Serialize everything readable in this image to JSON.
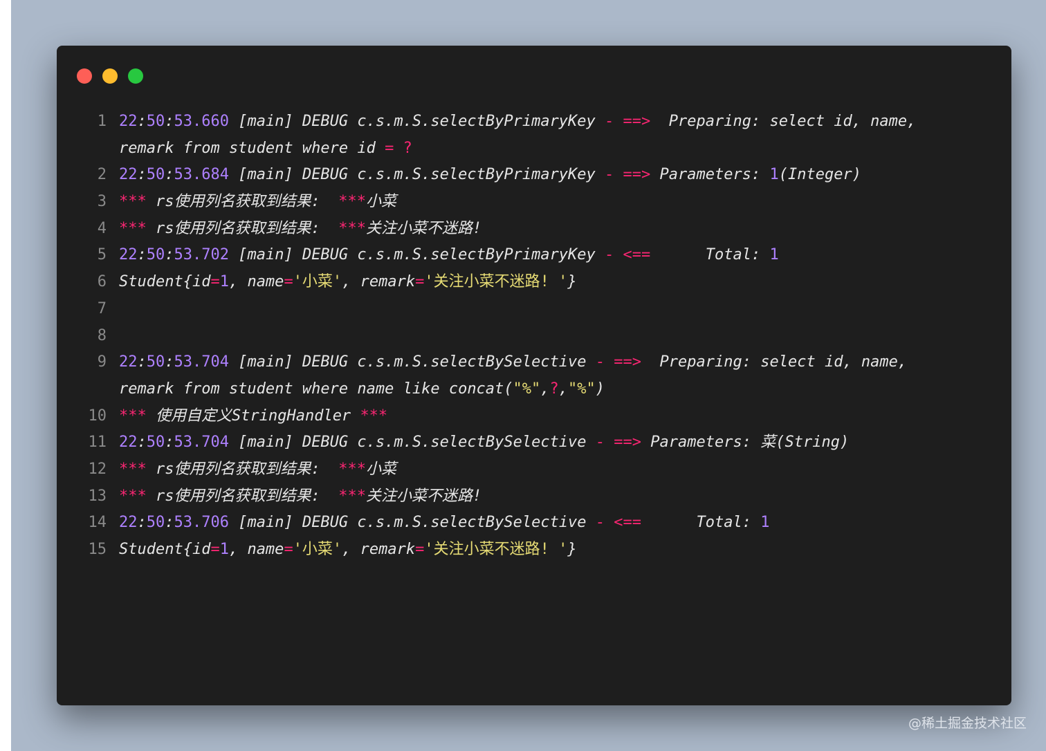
{
  "window": {
    "controls": [
      "close",
      "minimize",
      "maximize"
    ]
  },
  "lines": [
    {
      "num": "1",
      "rows": [
        [
          [
            "n",
            "22"
          ],
          [
            "p",
            ":"
          ],
          [
            "n",
            "50"
          ],
          [
            "p",
            ":"
          ],
          [
            "n",
            "53.660"
          ],
          [
            "p",
            " [main] DEBUG c.s.m.S.selectByPrimaryKey "
          ],
          [
            "op",
            "-"
          ],
          [
            "p",
            " "
          ],
          [
            "op",
            "==>"
          ],
          [
            "p",
            "  Preparing: select id, name,"
          ]
        ],
        [
          [
            "p",
            "remark from student where id "
          ],
          [
            "op",
            "="
          ],
          [
            "p",
            " "
          ],
          [
            "op",
            "?"
          ]
        ]
      ]
    },
    {
      "num": "2",
      "rows": [
        [
          [
            "n",
            "22"
          ],
          [
            "p",
            ":"
          ],
          [
            "n",
            "50"
          ],
          [
            "p",
            ":"
          ],
          [
            "n",
            "53.684"
          ],
          [
            "p",
            " [main] DEBUG c.s.m.S.selectByPrimaryKey "
          ],
          [
            "op",
            "-"
          ],
          [
            "p",
            " "
          ],
          [
            "op",
            "==>"
          ],
          [
            "p",
            " Parameters: "
          ],
          [
            "n",
            "1"
          ],
          [
            "p",
            "(Integer)"
          ]
        ]
      ]
    },
    {
      "num": "3",
      "rows": [
        [
          [
            "op",
            "***"
          ],
          [
            "p",
            " rs使用列名获取到结果:  "
          ],
          [
            "op",
            "***"
          ],
          [
            "p",
            "小菜"
          ]
        ]
      ]
    },
    {
      "num": "4",
      "rows": [
        [
          [
            "op",
            "***"
          ],
          [
            "p",
            " rs使用列名获取到结果:  "
          ],
          [
            "op",
            "***"
          ],
          [
            "p",
            "关注小菜不迷路!"
          ]
        ]
      ]
    },
    {
      "num": "5",
      "rows": [
        [
          [
            "n",
            "22"
          ],
          [
            "p",
            ":"
          ],
          [
            "n",
            "50"
          ],
          [
            "p",
            ":"
          ],
          [
            "n",
            "53.702"
          ],
          [
            "p",
            " [main] DEBUG c.s.m.S.selectByPrimaryKey "
          ],
          [
            "op",
            "-"
          ],
          [
            "p",
            " "
          ],
          [
            "op",
            "<=="
          ],
          [
            "p",
            "      Total: "
          ],
          [
            "n",
            "1"
          ]
        ]
      ]
    },
    {
      "num": "6",
      "rows": [
        [
          [
            "p",
            "Student{id"
          ],
          [
            "op",
            "="
          ],
          [
            "n",
            "1"
          ],
          [
            "p",
            ", name"
          ],
          [
            "op",
            "="
          ],
          [
            "s",
            "'小菜'"
          ],
          [
            "p",
            ", remark"
          ],
          [
            "op",
            "="
          ],
          [
            "s",
            "'关注小菜不迷路! '"
          ],
          [
            "p",
            "}"
          ]
        ]
      ]
    },
    {
      "num": "7",
      "rows": [
        [
          [
            "p",
            ""
          ]
        ]
      ]
    },
    {
      "num": "8",
      "rows": [
        [
          [
            "p",
            ""
          ]
        ]
      ]
    },
    {
      "num": "9",
      "rows": [
        [
          [
            "n",
            "22"
          ],
          [
            "p",
            ":"
          ],
          [
            "n",
            "50"
          ],
          [
            "p",
            ":"
          ],
          [
            "n",
            "53.704"
          ],
          [
            "p",
            " [main] DEBUG c.s.m.S.selectBySelective "
          ],
          [
            "op",
            "-"
          ],
          [
            "p",
            " "
          ],
          [
            "op",
            "==>"
          ],
          [
            "p",
            "  Preparing: select id, name,"
          ]
        ],
        [
          [
            "p",
            "remark from student where name like concat("
          ],
          [
            "s",
            "\"%\""
          ],
          [
            "p",
            ","
          ],
          [
            "op",
            "?"
          ],
          [
            "p",
            ","
          ],
          [
            "s",
            "\"%\""
          ],
          [
            "p",
            ")"
          ]
        ]
      ]
    },
    {
      "num": "10",
      "rows": [
        [
          [
            "op",
            "***"
          ],
          [
            "p",
            " 使用自定义StringHandler "
          ],
          [
            "op",
            "***"
          ]
        ]
      ]
    },
    {
      "num": "11",
      "rows": [
        [
          [
            "n",
            "22"
          ],
          [
            "p",
            ":"
          ],
          [
            "n",
            "50"
          ],
          [
            "p",
            ":"
          ],
          [
            "n",
            "53.704"
          ],
          [
            "p",
            " [main] DEBUG c.s.m.S.selectBySelective "
          ],
          [
            "op",
            "-"
          ],
          [
            "p",
            " "
          ],
          [
            "op",
            "==>"
          ],
          [
            "p",
            " Parameters: 菜(String)"
          ]
        ]
      ]
    },
    {
      "num": "12",
      "rows": [
        [
          [
            "op",
            "***"
          ],
          [
            "p",
            " rs使用列名获取到结果:  "
          ],
          [
            "op",
            "***"
          ],
          [
            "p",
            "小菜"
          ]
        ]
      ]
    },
    {
      "num": "13",
      "rows": [
        [
          [
            "op",
            "***"
          ],
          [
            "p",
            " rs使用列名获取到结果:  "
          ],
          [
            "op",
            "***"
          ],
          [
            "p",
            "关注小菜不迷路!"
          ]
        ]
      ]
    },
    {
      "num": "14",
      "rows": [
        [
          [
            "n",
            "22"
          ],
          [
            "p",
            ":"
          ],
          [
            "n",
            "50"
          ],
          [
            "p",
            ":"
          ],
          [
            "n",
            "53.706"
          ],
          [
            "p",
            " [main] DEBUG c.s.m.S.selectBySelective "
          ],
          [
            "op",
            "-"
          ],
          [
            "p",
            " "
          ],
          [
            "op",
            "<=="
          ],
          [
            "p",
            "      Total: "
          ],
          [
            "n",
            "1"
          ]
        ]
      ]
    },
    {
      "num": "15",
      "rows": [
        [
          [
            "p",
            "Student{id"
          ],
          [
            "op",
            "="
          ],
          [
            "n",
            "1"
          ],
          [
            "p",
            ", name"
          ],
          [
            "op",
            "="
          ],
          [
            "s",
            "'小菜'"
          ],
          [
            "p",
            ", remark"
          ],
          [
            "op",
            "="
          ],
          [
            "s",
            "'关注小菜不迷路! '"
          ],
          [
            "p",
            "}"
          ]
        ]
      ]
    }
  ],
  "colors": {
    "number": "#ae81ff",
    "operator": "#f92672",
    "string": "#e6db74",
    "text": "#e6e6e6",
    "line_number": "#8a8a8a",
    "window_bg": "#1e1e1e",
    "backdrop": "#abb8c9"
  },
  "watermark": "@稀土掘金技术社区"
}
